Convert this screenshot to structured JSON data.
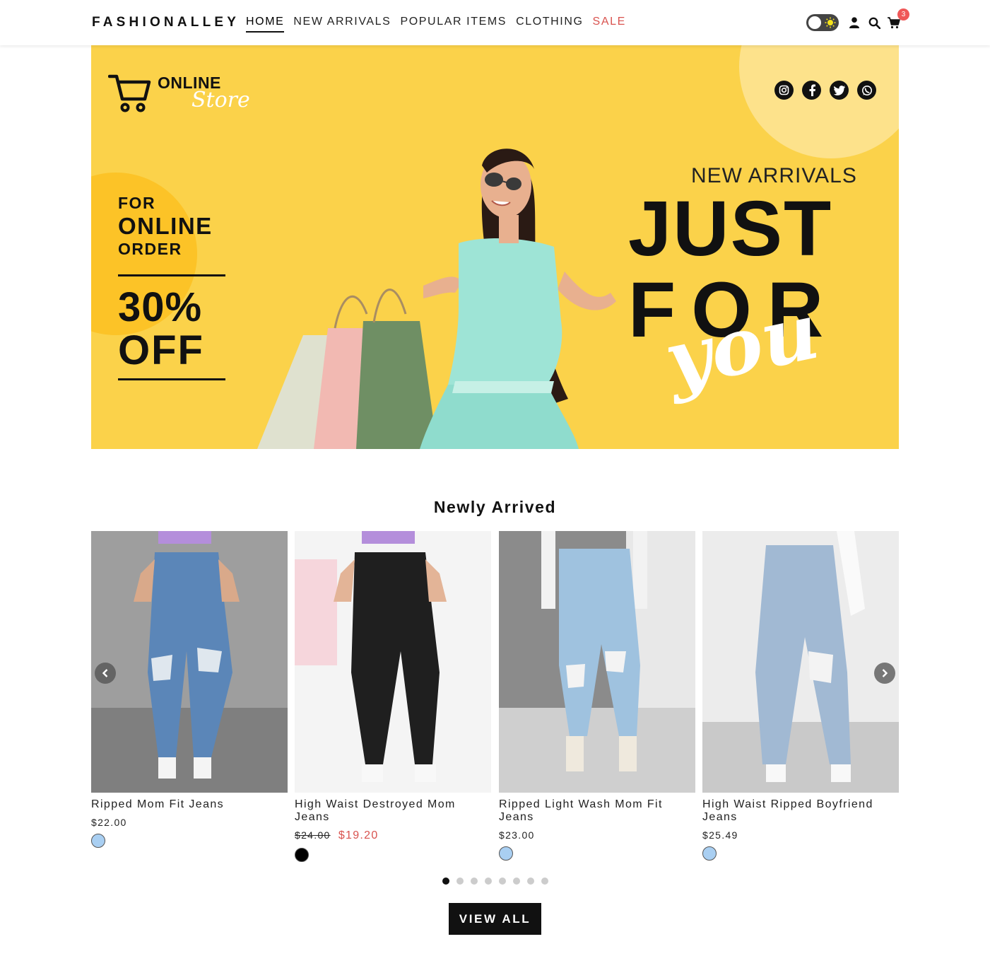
{
  "header": {
    "logo": "FASHIONALLEY",
    "nav": [
      {
        "label": "HOME",
        "active": true
      },
      {
        "label": "NEW ARRIVALS"
      },
      {
        "label": "POPULAR ITEMS"
      },
      {
        "label": "CLOTHING"
      },
      {
        "label": "SALE",
        "highlight": "#d9534f"
      }
    ],
    "icons": [
      "theme-toggle",
      "user-icon",
      "search-icon",
      "cart-icon"
    ],
    "cart_count": "3"
  },
  "hero": {
    "store_brand": "ONLINE",
    "store_script": "Store",
    "offer_line1": "FOR",
    "offer_line2": "ONLINE",
    "offer_line3": "ORDER",
    "discount_value": "30%",
    "discount_word": "OFF",
    "arrivals_label": "NEW ARRIVALS",
    "headline_1": "JUST",
    "headline_2": "FOR",
    "headline_script": "you",
    "socials": [
      "instagram-icon",
      "facebook-icon",
      "twitter-icon",
      "whatsapp-icon"
    ],
    "bg_color": "#fbd24a"
  },
  "section": {
    "title": "Newly Arrived",
    "products": [
      {
        "name": "Ripped Mom Fit Jeans",
        "price": "$22.00",
        "swatch": "#a9cff2"
      },
      {
        "name": "High Waist Destroyed Mom Jeans",
        "old_price": "$24.00",
        "sale_price": "$19.20",
        "swatch": "#000000"
      },
      {
        "name": "Ripped Light Wash Mom Fit Jeans",
        "price": "$23.00",
        "swatch": "#a9cff2"
      },
      {
        "name": "High Waist Ripped Boyfriend Jeans",
        "price": "$25.49",
        "swatch": "#a9cff2"
      }
    ],
    "dot_count": 8,
    "active_dot": 0,
    "view_all_label": "VIEW ALL"
  }
}
